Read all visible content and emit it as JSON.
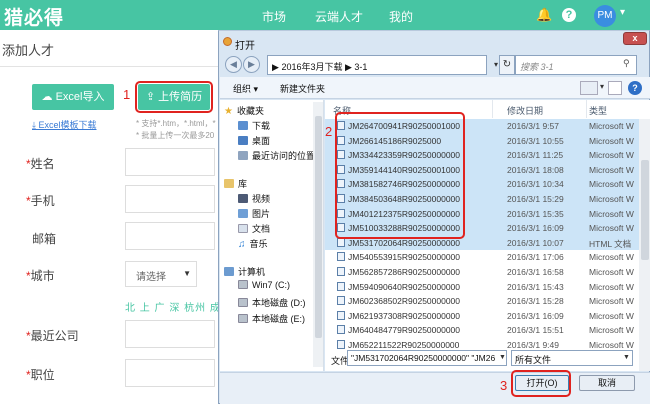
{
  "app": {
    "logo": "猎必得",
    "nav": [
      "市场",
      "云端人才",
      "我的"
    ],
    "avatar": "PM"
  },
  "page": {
    "title": "添加人才",
    "excel_import": "Excel导入",
    "upload_resume": "上传简历",
    "template_link": "Excel模板下载",
    "hint_formats": "* 支持*.htm，*.html，*",
    "hint_batch": "* 批量上传一次最多20",
    "fields": {
      "name": "姓名",
      "phone": "手机",
      "email": "邮箱",
      "city": "城市",
      "recent_company": "最近公司",
      "position": "职位"
    },
    "city_select": "请选择",
    "hot_cities": "北 上 广 深 杭州 成都"
  },
  "annotations": [
    "1",
    "2",
    "3"
  ],
  "dialog": {
    "title": "打开",
    "close": "x",
    "breadcrumb": [
      "2016年3月下载",
      "3-1"
    ],
    "search_placeholder": "搜索 3-1",
    "toolbar": {
      "organize": "组织 ▾",
      "new_folder": "新建文件夹"
    },
    "nav_pane": {
      "favorites": "收藏夹",
      "downloads": "下载",
      "desktop": "桌面",
      "recent": "最近访问的位置",
      "libraries": "库",
      "videos": "视频",
      "pictures": "图片",
      "documents": "文档",
      "music": "音乐",
      "computer": "计算机",
      "drive_c": "Win7 (C:)",
      "drive_d": "本地磁盘 (D:)",
      "drive_e": "本地磁盘 (E:)"
    },
    "columns": {
      "name": "名称",
      "date": "修改日期",
      "type": "类型"
    },
    "files": [
      {
        "name": "JM264700941R90250001000",
        "date": "2016/3/1 9:57",
        "type": "Microsoft W",
        "selected": true
      },
      {
        "name": "JM266145186R9025000",
        "date": "2016/3/1 10:55",
        "type": "Microsoft W",
        "selected": true
      },
      {
        "name": "JM334423359R90250000000",
        "date": "2016/3/1 11:25",
        "type": "Microsoft W",
        "selected": true
      },
      {
        "name": "JM359144140R90250001000",
        "date": "2016/3/1 18:08",
        "type": "Microsoft W",
        "selected": true
      },
      {
        "name": "JM381582746R90250000000",
        "date": "2016/3/1 10:34",
        "type": "Microsoft W",
        "selected": true
      },
      {
        "name": "JM384503648R90250000000",
        "date": "2016/3/1 15:29",
        "type": "Microsoft W",
        "selected": true
      },
      {
        "name": "JM401212375R90250000000",
        "date": "2016/3/1 15:35",
        "type": "Microsoft W",
        "selected": true
      },
      {
        "name": "JM510033288R90250000000",
        "date": "2016/3/1 16:09",
        "type": "Microsoft W",
        "selected": true
      },
      {
        "name": "JM531702064R90250000000",
        "date": "2016/3/1 10:07",
        "type": "HTML 文档",
        "selected": true
      },
      {
        "name": "JM540553915R90250000000",
        "date": "2016/3/1 17:06",
        "type": "Microsoft W",
        "selected": false
      },
      {
        "name": "JM562857286R90250000000",
        "date": "2016/3/1 16:58",
        "type": "Microsoft W",
        "selected": false
      },
      {
        "name": "JM594090640R90250000000",
        "date": "2016/3/1 15:43",
        "type": "Microsoft W",
        "selected": false
      },
      {
        "name": "JM602368502R90250000000",
        "date": "2016/3/1 15:28",
        "type": "Microsoft W",
        "selected": false
      },
      {
        "name": "JM621937308R90250000000",
        "date": "2016/3/1 16:09",
        "type": "Microsoft W",
        "selected": false
      },
      {
        "name": "JM640484779R90250000000",
        "date": "2016/3/1 15:51",
        "type": "Microsoft W",
        "selected": false
      },
      {
        "name": "JM652211522R90250000000",
        "date": "2016/3/1 9:49",
        "type": "Microsoft W",
        "selected": false
      }
    ],
    "filename_label": "文件名(N):",
    "filename_value": "\"JM531702064R90250000000\" \"JM26",
    "filetype": "所有文件",
    "open": "打开(O)",
    "cancel": "取消"
  },
  "colors": {
    "brand": "#47c5a3",
    "annotation": "#e0231f",
    "selection": "#cce4f7"
  }
}
